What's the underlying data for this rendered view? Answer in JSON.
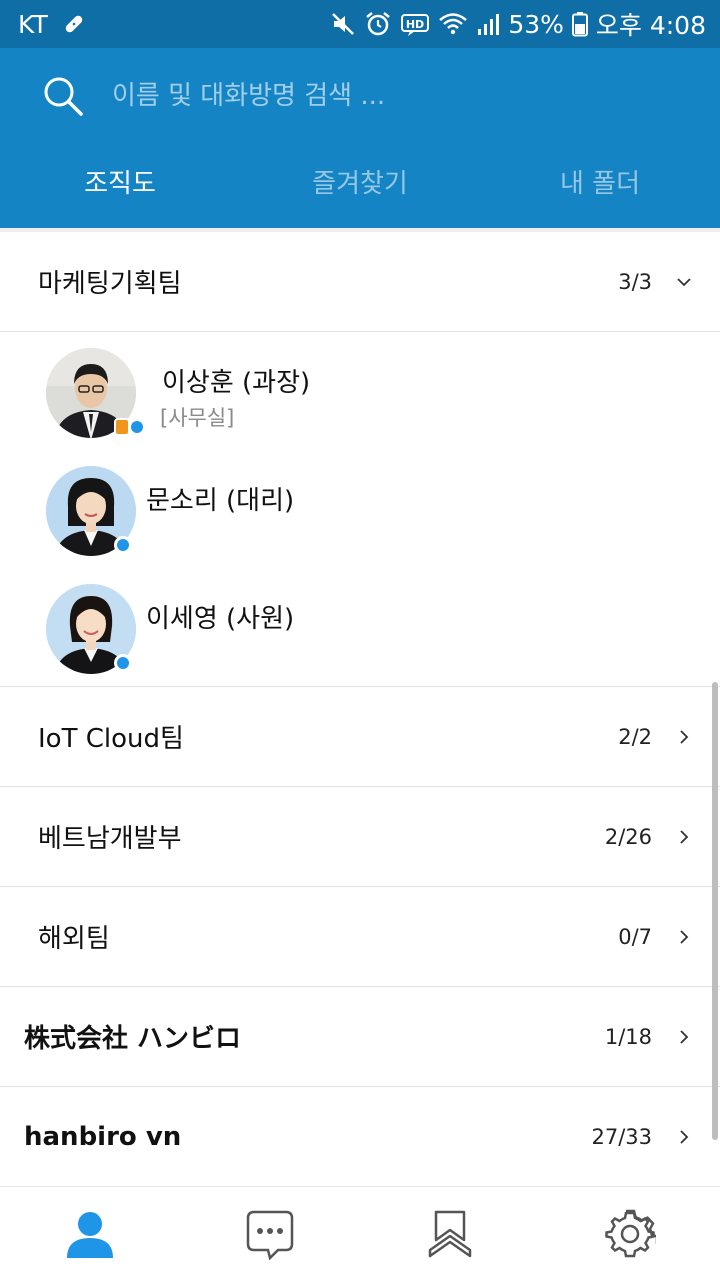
{
  "status_bar": {
    "carrier": "KT",
    "battery": "53%",
    "time": "오후 4:08",
    "hd_label": "HD",
    "icons": [
      "bandage-icon",
      "mute-icon",
      "alarm-icon",
      "hd-icon",
      "wifi-icon",
      "signal-icon",
      "battery-icon"
    ]
  },
  "search": {
    "placeholder": "이름 및 대화방명 검색 ..."
  },
  "tabs": [
    {
      "label": "조직도",
      "active": true
    },
    {
      "label": "즐겨찾기",
      "active": false
    },
    {
      "label": "내 폴더",
      "active": false
    }
  ],
  "groups": [
    {
      "name": "마케팅기획팀",
      "count": "3/3",
      "expanded": true,
      "members": [
        {
          "name": "이상훈 (과장)",
          "status_text": "[사무실]"
        },
        {
          "name": "문소리 (대리)"
        },
        {
          "name": "이세영 (사원)"
        }
      ]
    },
    {
      "name": "IoT Cloud팀",
      "count": "2/2"
    },
    {
      "name": "베트남개발부",
      "count": "2/26"
    },
    {
      "name": "해외팀",
      "count": "0/7"
    },
    {
      "name": "株式会社 ハンビロ",
      "count": "1/18"
    },
    {
      "name": "hanbiro vn",
      "count": "27/33"
    }
  ],
  "bottom_nav": [
    {
      "icon": "person-icon",
      "active": true
    },
    {
      "icon": "chat-bubble-icon",
      "active": false
    },
    {
      "icon": "bookmark-icon",
      "active": false
    },
    {
      "icon": "gear-icon",
      "active": false
    }
  ],
  "colors": {
    "status_bar": "#0f6ea6",
    "app_bar": "#1484c4",
    "accent": "#1f95e8",
    "busy": "#f0961e"
  }
}
